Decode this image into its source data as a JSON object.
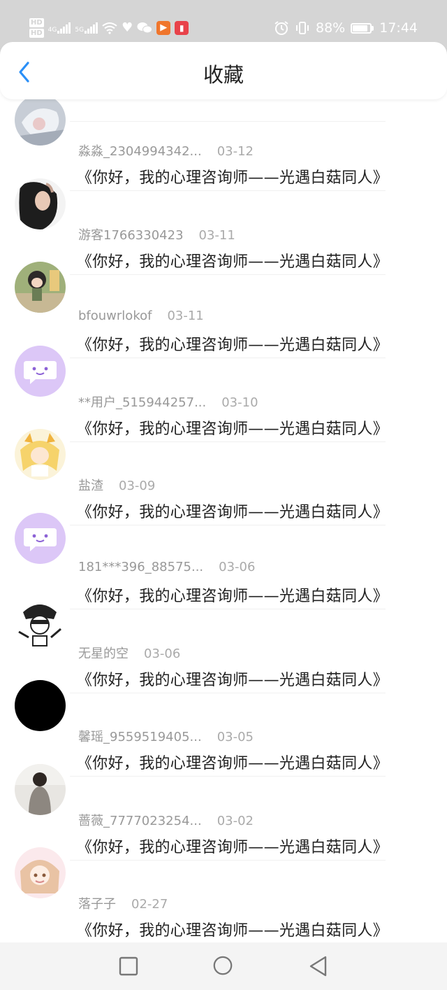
{
  "status": {
    "hd1": "HD",
    "hd2": "HD",
    "net1": "4G",
    "net2": "5G",
    "battery_pct": "88%",
    "time": "17:44",
    "battery_level": 0.88
  },
  "header": {
    "title": "收藏"
  },
  "favorites": [
    {
      "user": "淼淼_2304994342...",
      "date": "03-12",
      "content": "《你好，我的心理咨询师——光遇白菇同人》",
      "avatar": "anime-gray"
    },
    {
      "user": "游客1766330423",
      "date": "03-11",
      "content": "《你好，我的心理咨询师——光遇白菇同人》",
      "avatar": "photo-woman"
    },
    {
      "user": "bfouwrlokof",
      "date": "03-11",
      "content": "《你好，我的心理咨询师——光遇白菇同人》",
      "avatar": "figurine"
    },
    {
      "user": "**用户_515944257...",
      "date": "03-10",
      "content": "《你好，我的心理咨询师——光遇白菇同人》",
      "avatar": "default-purple"
    },
    {
      "user": "盐渣",
      "date": "03-09",
      "content": "《你好，我的心理咨询师——光遇白菇同人》",
      "avatar": "anime-yellow"
    },
    {
      "user": "181***396_88575...",
      "date": "03-06",
      "content": "《你好，我的心理咨询师——光遇白菇同人》",
      "avatar": "default-purple"
    },
    {
      "user": "无星的空",
      "date": "03-06",
      "content": "《你好，我的心理咨询师——光遇白菇同人》",
      "avatar": "anime-sketch"
    },
    {
      "user": "馨瑶_9559519405...",
      "date": "03-05",
      "content": "《你好，我的心理咨询师——光遇白菇同人》",
      "avatar": "black"
    },
    {
      "user": "蔷薇_7777023254...",
      "date": "03-02",
      "content": "《你好，我的心理咨询师——光遇白菇同人》",
      "avatar": "photo-back"
    },
    {
      "user": "落子子",
      "date": "02-27",
      "content": "《你好，我的心理咨询师——光遇白菇同人》",
      "avatar": "anime-pink"
    }
  ],
  "colors": {
    "accent": "#2a8ff7",
    "default_avatar_bg": "#d9c2f7",
    "statusbar_bg": "#d5d5d5"
  }
}
